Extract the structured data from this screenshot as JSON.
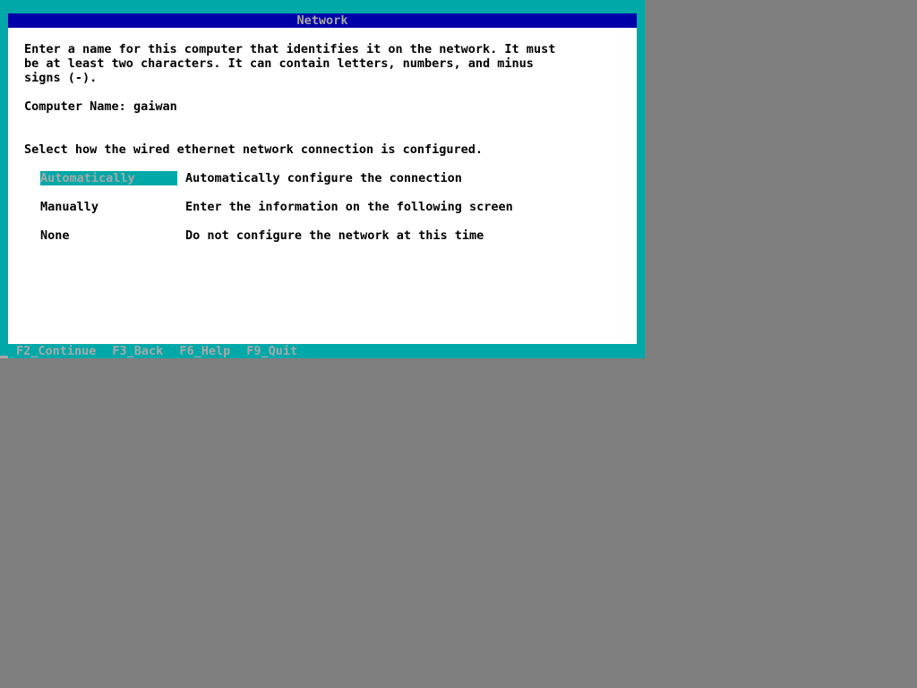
{
  "window": {
    "title": "Network"
  },
  "intro": {
    "line1": "Enter a name for this computer that identifies it on the network. It must",
    "line2": "be at least two characters. It can contain letters, numbers, and minus",
    "line3": "signs (-)."
  },
  "computer_name": {
    "label": "Computer Name:",
    "value": "gaiwan"
  },
  "network": {
    "prompt": "Select how the wired ethernet network connection is configured.",
    "options": [
      {
        "key": "Automatically",
        "description": "Automatically configure the connection",
        "selected": true
      },
      {
        "key": "Manually",
        "description": "Enter the information on the following screen",
        "selected": false
      },
      {
        "key": "None",
        "description": "Do not configure the network at this time",
        "selected": false
      }
    ]
  },
  "footer": {
    "keys": [
      "F2_Continue",
      "F3_Back",
      "F6_Help",
      "F9_Quit"
    ]
  },
  "colors": {
    "background": "#7f7f7f",
    "frame": "#00a8a8",
    "title_bar": "#0000a8",
    "dialog": "#ffffff",
    "highlight_text": "#a8a8a8"
  }
}
